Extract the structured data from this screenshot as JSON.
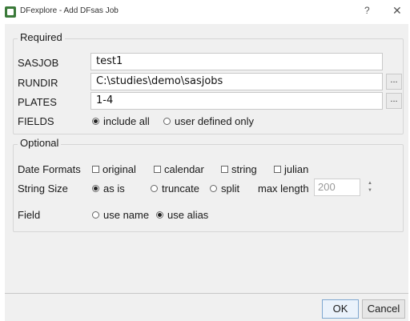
{
  "window": {
    "title": "DFexplore - Add DFsas Job",
    "help_glyph": "?",
    "close_glyph": "✕"
  },
  "required": {
    "title": "Required",
    "sasjob_label": "SASJOB",
    "sasjob_value": "test1",
    "rundir_label": "RUNDIR",
    "rundir_value": "C:\\studies\\demo\\sasjobs",
    "plates_label": "PLATES",
    "plates_value": "1-4",
    "browse_label": "...",
    "fields_label": "FIELDS",
    "fields_options": [
      "include all",
      "user defined only"
    ],
    "fields_selected": "include all"
  },
  "optional": {
    "title": "Optional",
    "date_formats_label": "Date Formats",
    "date_formats": [
      "original",
      "calendar",
      "string",
      "julian"
    ],
    "string_size_label": "String Size",
    "string_size_options": [
      "as is",
      "truncate",
      "split"
    ],
    "string_size_selected": "as is",
    "max_length_label": "max length",
    "max_length_value": "200",
    "field_label": "Field",
    "field_options": [
      "use name",
      "use alias"
    ],
    "field_selected": "use alias"
  },
  "buttons": {
    "ok": "OK",
    "cancel": "Cancel"
  }
}
